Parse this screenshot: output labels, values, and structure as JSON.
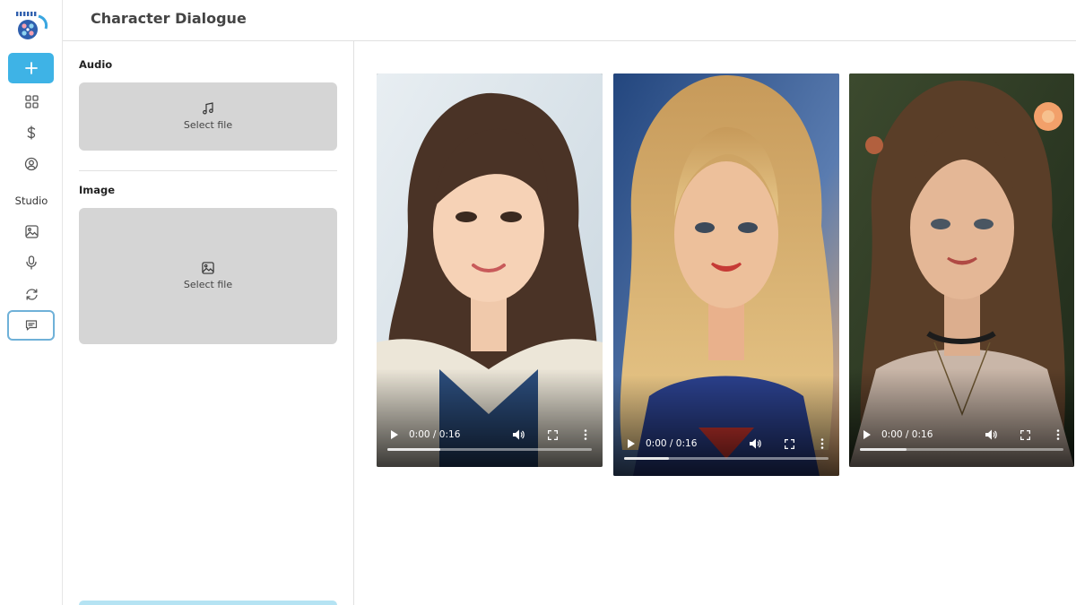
{
  "app": {
    "title": "Character Dialogue"
  },
  "sidebar": {
    "new_button_icon": "plus-icon",
    "items": [
      {
        "icon": "grid-icon"
      },
      {
        "icon": "dollar-icon"
      },
      {
        "icon": "user-circle-icon"
      }
    ],
    "studio_label": "Studio",
    "studio_items": [
      {
        "icon": "image-icon"
      },
      {
        "icon": "microphone-icon"
      },
      {
        "icon": "refresh-icon"
      },
      {
        "icon": "chat-icon",
        "active": true
      }
    ]
  },
  "form": {
    "audio": {
      "label": "Audio",
      "dropzone_text": "Select file",
      "icon": "music-note-icon"
    },
    "image": {
      "label": "Image",
      "dropzone_text": "Select file",
      "icon": "image-icon"
    }
  },
  "videos": [
    {
      "time": "0:00 / 0:16",
      "progress": 0.26,
      "palette": "anime-brunette"
    },
    {
      "time": "0:00 / 0:16",
      "progress": 0.22,
      "palette": "blonde-hero"
    },
    {
      "time": "0:00 / 0:16",
      "progress": 0.23,
      "palette": "floral-brunette"
    }
  ],
  "colors": {
    "accent": "#3eb3e6",
    "active_border": "#6fb1d8",
    "dropzone": "#d5d5d5"
  }
}
